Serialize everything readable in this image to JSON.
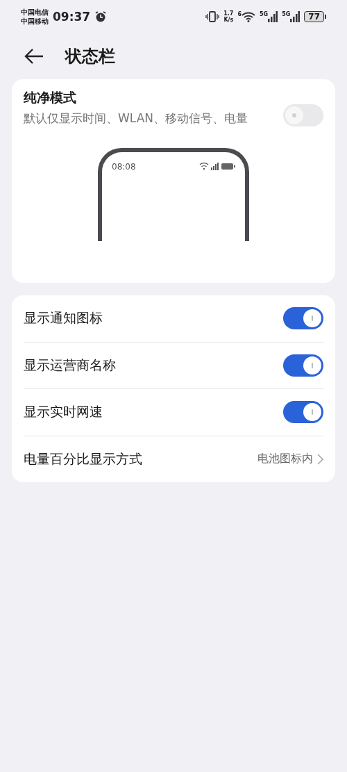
{
  "status_bar": {
    "carriers": [
      "中国电信",
      "中国移动"
    ],
    "time": "09:37",
    "speed": [
      "1.7",
      "K/s"
    ],
    "wifi_band": "6",
    "networks": [
      "5G",
      "5G"
    ],
    "battery": "77"
  },
  "header": {
    "title": "状态栏"
  },
  "pure_mode": {
    "title": "纯净模式",
    "description": "默认仅显示时间、WLAN、移动信号、电量",
    "on": false,
    "preview_time": "08:08"
  },
  "settings": [
    {
      "kind": "toggle",
      "label": "显示通知图标",
      "on": true
    },
    {
      "kind": "toggle",
      "label": "显示运营商名称",
      "on": true
    },
    {
      "kind": "toggle",
      "label": "显示实时网速",
      "on": true
    },
    {
      "kind": "value",
      "label": "电量百分比显示方式",
      "value": "电池图标内"
    }
  ]
}
